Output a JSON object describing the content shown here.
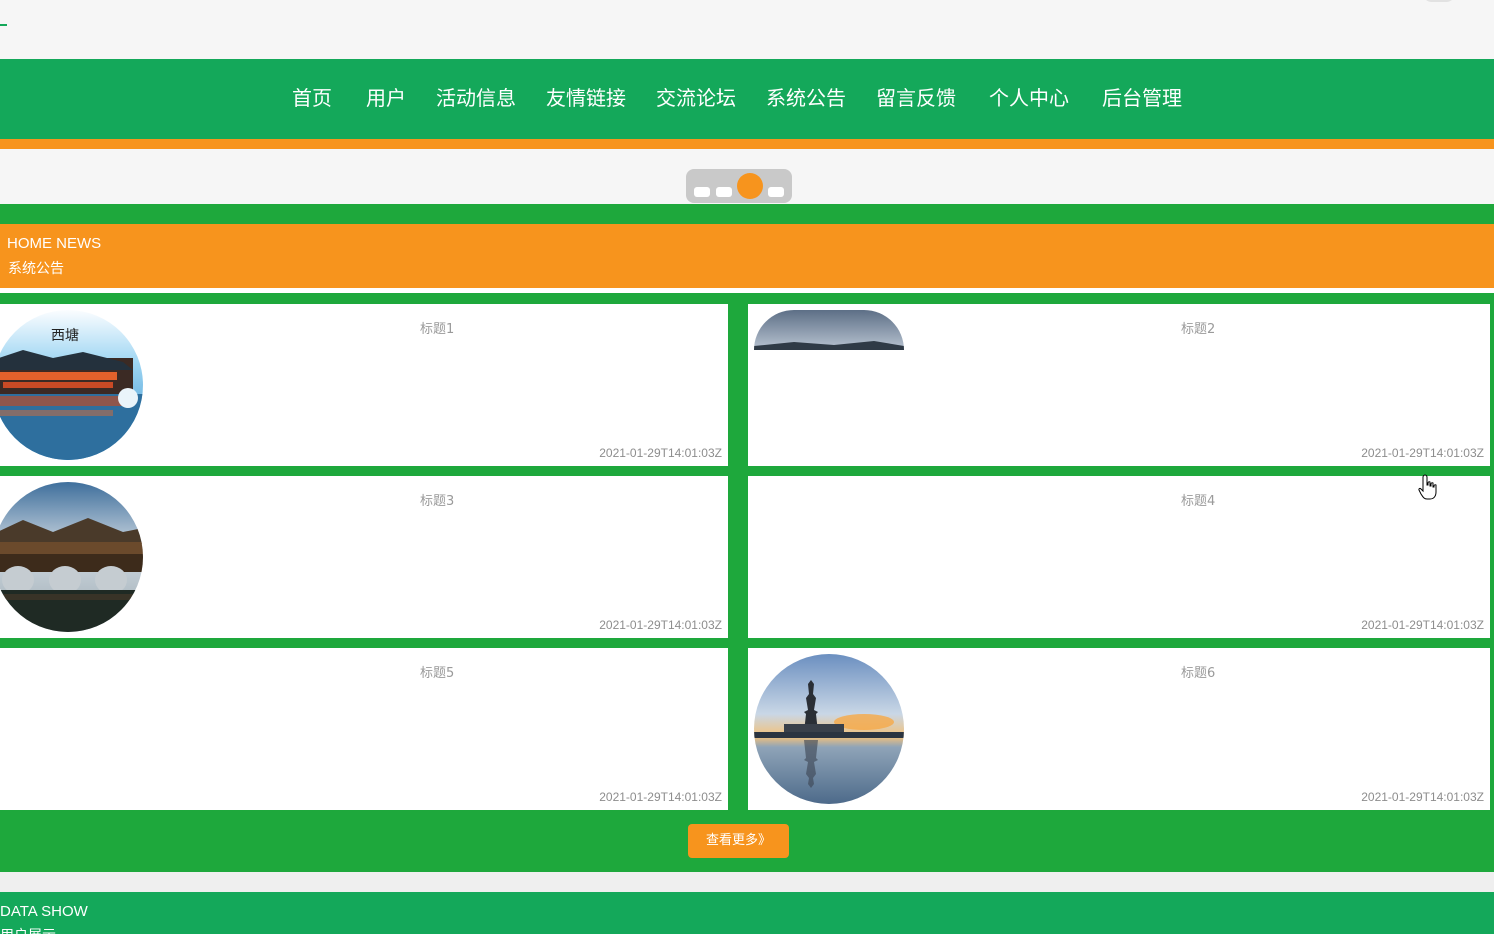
{
  "nav": {
    "items": [
      "首页",
      "用户",
      "活动信息",
      "友情链接",
      "交流论坛",
      "系统公告",
      "留言反馈",
      "个人中心",
      "后台管理"
    ]
  },
  "carousel": {
    "slide_count": 4,
    "active_index": 2
  },
  "news": {
    "heading_en": "HOME NEWS",
    "heading_cn": "系统公告",
    "cards": [
      {
        "title": "标题1",
        "time": "2021-01-29T14:01:03Z"
      },
      {
        "title": "标题2",
        "time": "2021-01-29T14:01:03Z"
      },
      {
        "title": "标题3",
        "time": "2021-01-29T14:01:03Z"
      },
      {
        "title": "标题4",
        "time": "2021-01-29T14:01:03Z"
      },
      {
        "title": "标题5",
        "time": "2021-01-29T14:01:03Z"
      },
      {
        "title": "标题6",
        "time": "2021-01-29T14:01:03Z"
      }
    ],
    "more_button": "查看更多》"
  },
  "data_show": {
    "heading_en": "DATA SHOW",
    "heading_cn": "用户展示"
  },
  "colors": {
    "nav_green": "#14a85a",
    "section_green": "#1ea83c",
    "accent_orange": "#f7941d"
  }
}
